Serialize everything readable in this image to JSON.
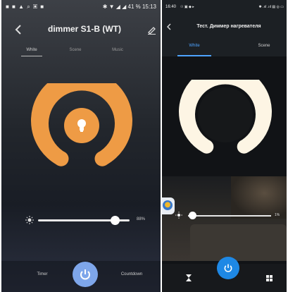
{
  "left": {
    "status": {
      "icons": "■ ■ ▲ ⌕ ▣ ■",
      "right": "✱ ▼ ◢ ◢ 41 % 15:13"
    },
    "header": {
      "back_icon": "chevron-left-icon",
      "title": "dimmer S1-B (WT)",
      "edit_icon": "pencil-icon"
    },
    "tabs": [
      {
        "label": "White",
        "active": true
      },
      {
        "label": "Scene",
        "active": false
      },
      {
        "label": "Music",
        "active": false
      }
    ],
    "control": {
      "color": "#ee9b45",
      "icon": "light-bulb-icon"
    },
    "brightness": {
      "icon": "sun-icon",
      "value_label": "88%",
      "level": 0.88
    },
    "bottom": {
      "left_label": "Timer",
      "power_icon": "power-icon",
      "right_label": "Countdown"
    }
  },
  "right": {
    "status": {
      "time": "16:40",
      "left_icons": "☉ ▣ ◆ ▸",
      "right_icons": "✱ .ııl .ııl ▤ ◎ ▭"
    },
    "header": {
      "back_icon": "chevron-left-icon",
      "title": "Тест. Диммер нагревателя"
    },
    "tabs": [
      {
        "label": "White",
        "active": true
      },
      {
        "label": "Scene",
        "active": false
      }
    ],
    "control": {
      "color": "#fdf5e4"
    },
    "brightness": {
      "icon": "sun-icon",
      "value_label": "1%",
      "level": 0.01
    },
    "bottom": {
      "timer_icon": "hourglass-icon",
      "power_icon": "power-icon",
      "grid_icon": "grid-icon"
    }
  },
  "colors": {
    "accent_blue": "#1e88e5",
    "tab_active": "#4da3ff",
    "left_power": "#7ea6ea"
  }
}
